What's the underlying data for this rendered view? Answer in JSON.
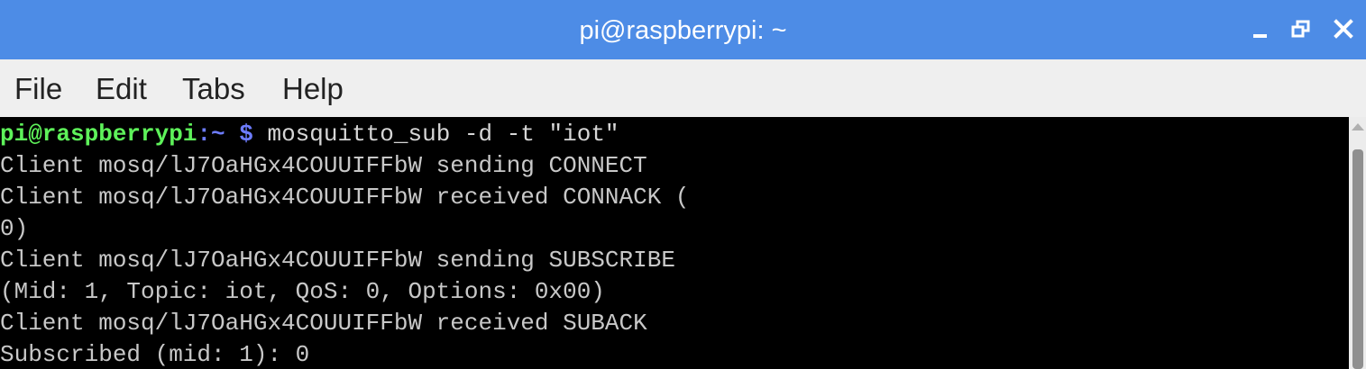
{
  "window": {
    "title": "pi@raspberrypi: ~",
    "controls": [
      "minimize-icon",
      "maximize-icon",
      "close-icon"
    ]
  },
  "menu": {
    "file": "File",
    "edit": "Edit",
    "tabs": "Tabs",
    "help": "Help"
  },
  "terminal": {
    "prompt_user": "pi@raspberrypi",
    "prompt_path": ":~ ",
    "prompt_symbol": "$",
    "command": " mosquitto_sub -d -t \"iot\"",
    "output": [
      "Client mosq/lJ7OaHGx4COUUIFFbW sending CONNECT",
      "Client mosq/lJ7OaHGx4COUUIFFbW received CONNACK (",
      "0)",
      "Client mosq/lJ7OaHGx4COUUIFFbW sending SUBSCRIBE",
      "(Mid: 1, Topic: iot, QoS: 0, Options: 0x00)",
      "Client mosq/lJ7OaHGx4COUUIFFbW received SUBACK",
      "Subscribed (mid: 1): 0"
    ]
  },
  "colors": {
    "titlebar": "#4d8ce6",
    "menubar": "#efefef",
    "terminal_bg": "#000000",
    "terminal_text": "#c8c8c8",
    "prompt_user": "#5ef25a",
    "prompt_path": "#6d7cff"
  }
}
